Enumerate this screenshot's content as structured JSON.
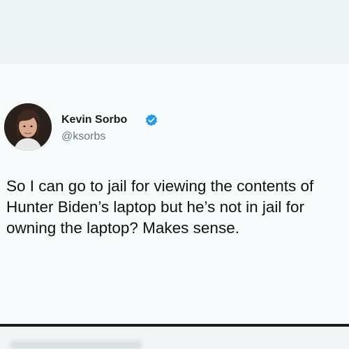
{
  "tweet": {
    "author": {
      "display_name": "Kevin Sorbo",
      "handle": "@ksorbs",
      "verified": true,
      "verified_color": "#1d9bf0",
      "avatar_icon": "profile-photo"
    },
    "text": "So I can go to jail for viewing the contents of Hunter Biden’s laptop but he’s not in jail for owning the laptop? Makes sense."
  },
  "colors": {
    "background": "#f2f7f8",
    "text": "#111111",
    "handle": "#6b7880",
    "divider": "#1c1c1c"
  }
}
